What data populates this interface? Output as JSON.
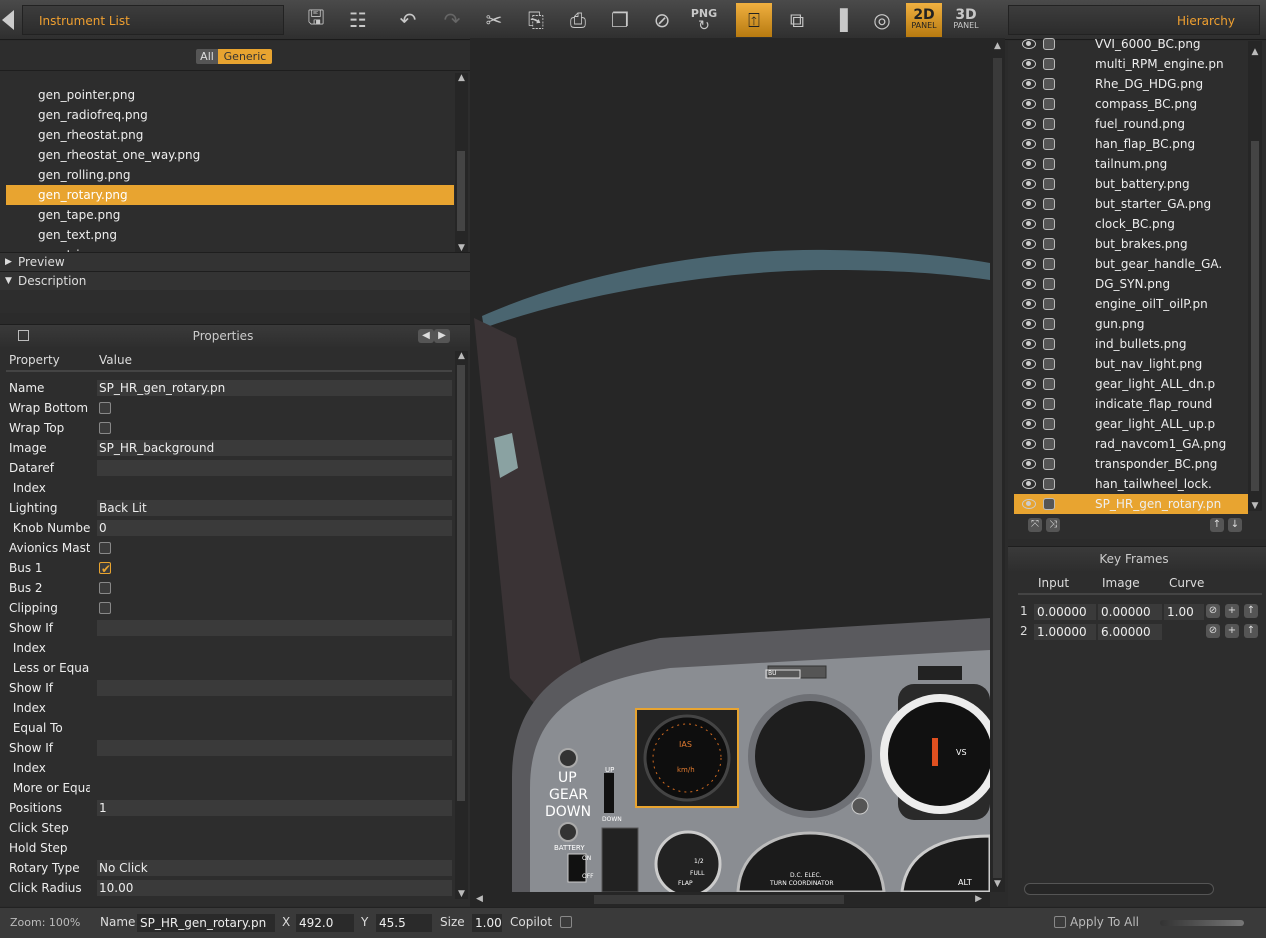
{
  "topbar": {
    "left_tab": "Instrument List",
    "right_tab": "Hierarchy",
    "png_label": "PNG",
    "panel_2d": "2D",
    "panel_3d": "3D",
    "panel_word": "PANEL"
  },
  "instrument_list": {
    "filter_all": "All",
    "filter_generic": "Generic",
    "items": [
      "gen_pointer.png",
      "gen_radiofreq.png",
      "gen_rheostat.png",
      "gen_rheostat_one_way.png",
      "gen_rolling.png",
      "gen_rotary.png",
      "gen_tape.png",
      "gen_text.png",
      "gen_trigger.png"
    ],
    "selected_index": 5,
    "preview_label": "Preview",
    "description_label": "Description"
  },
  "properties": {
    "title": "Properties",
    "col_property": "Property",
    "col_value": "Value",
    "rows": [
      {
        "name": "Name",
        "value": "SP_HR_gen_rotary.pn",
        "kind": "field"
      },
      {
        "name": "Wrap Bottom",
        "kind": "check",
        "checked": false
      },
      {
        "name": "Wrap Top",
        "kind": "check",
        "checked": false
      },
      {
        "name": "Image",
        "value": "SP_HR_background",
        "kind": "field"
      },
      {
        "name": "Dataref",
        "value": "",
        "kind": "field"
      },
      {
        "name": " Index",
        "kind": "none"
      },
      {
        "name": "Lighting",
        "value": "Back Lit",
        "kind": "field"
      },
      {
        "name": " Knob Number",
        "value": "0",
        "kind": "field"
      },
      {
        "name": "Avionics Master",
        "kind": "check",
        "checked": false
      },
      {
        "name": "Bus 1",
        "kind": "check",
        "checked": true
      },
      {
        "name": "Bus 2",
        "kind": "check",
        "checked": false
      },
      {
        "name": "Clipping",
        "kind": "check",
        "checked": false
      },
      {
        "name": "Show If",
        "value": "",
        "kind": "field"
      },
      {
        "name": " Index",
        "kind": "none"
      },
      {
        "name": " Less or Equal...",
        "kind": "none"
      },
      {
        "name": "Show If",
        "value": "",
        "kind": "field"
      },
      {
        "name": " Index",
        "kind": "none"
      },
      {
        "name": " Equal To",
        "kind": "none"
      },
      {
        "name": "Show If",
        "value": "",
        "kind": "field"
      },
      {
        "name": " Index",
        "kind": "none"
      },
      {
        "name": " More or Equa...",
        "kind": "none"
      },
      {
        "name": "Positions",
        "value": "1",
        "kind": "field"
      },
      {
        "name": "Click Step",
        "kind": "none"
      },
      {
        "name": "Hold Step",
        "kind": "none"
      },
      {
        "name": "Rotary Type",
        "value": "No Click",
        "kind": "field"
      },
      {
        "name": "Click Radius",
        "value": "10.00",
        "kind": "field"
      }
    ]
  },
  "canvas": {
    "gear_up": "UP",
    "gear_word": "GEAR",
    "gear_down": "DOWN",
    "battery": "BATTERY",
    "on": "ON",
    "off": "OFF",
    "flap": "FLAP",
    "full": "FULL",
    "half": "1/2",
    "dc_elec": "D.C. ELEC.",
    "turn_coord": "TURN COORDINATOR",
    "alt": "ALT",
    "vs": "VS",
    "ias": "IAS",
    "kmh": "km/h",
    "up_small": "UP",
    "down_small": "DOWN",
    "bu": "BU"
  },
  "hierarchy": {
    "items": [
      "VVI_6000_BC.png",
      "multi_RPM_engine.pn",
      "Rhe_DG_HDG.png",
      "compass_BC.png",
      "fuel_round.png",
      "han_flap_BC.png",
      "tailnum.png",
      "but_battery.png",
      "but_starter_GA.png",
      "clock_BC.png",
      "but_brakes.png",
      "but_gear_handle_GA.",
      "DG_SYN.png",
      "engine_oilT_oilP.pn",
      "gun.png",
      "ind_bullets.png",
      "but_nav_light.png",
      "gear_light_ALL_dn.p",
      "indicate_flap_round",
      "gear_light_ALL_up.p",
      "rad_navcom1_GA.png",
      "transponder_BC.png",
      "han_tailwheel_lock.",
      "SP_HR_gen_rotary.pn"
    ],
    "selected_index": 23
  },
  "keyframes": {
    "title": "Key Frames",
    "col_input": "Input",
    "col_image": "Image",
    "col_curve": "Curve",
    "rows": [
      {
        "n": "1",
        "input": "0.00000",
        "image": "0.00000",
        "curve": "1.00"
      },
      {
        "n": "2",
        "input": "1.00000",
        "image": "6.00000",
        "curve": ""
      }
    ]
  },
  "status": {
    "zoom": "Zoom: 100%",
    "name_label": "Name",
    "name_value": "SP_HR_gen_rotary.pn",
    "x_label": "X",
    "x_value": "492.0",
    "y_label": "Y",
    "y_value": "45.5",
    "size_label": "Size",
    "size_value": "1.00",
    "copilot_label": "Copilot",
    "apply_all": "Apply To All"
  },
  "colors": {
    "accent": "#e8a430",
    "bg": "#2b2b2b",
    "canvas": "#262626"
  }
}
